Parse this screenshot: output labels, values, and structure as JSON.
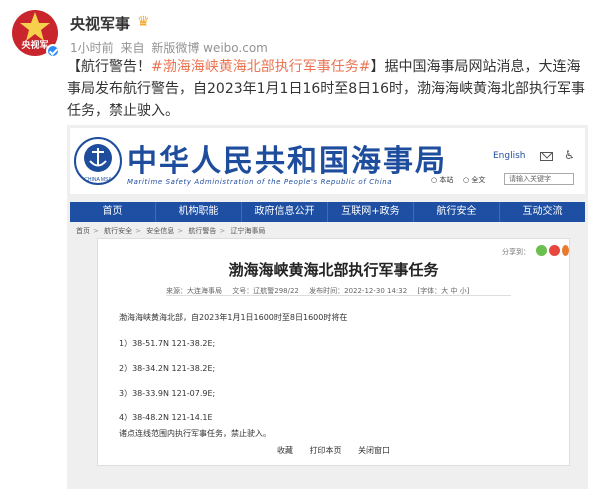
{
  "account": {
    "name": "央视军事",
    "avatar_text": "央视军",
    "time": "1小时前",
    "source_prefix": "来自",
    "source": "新版微博 weibo.com"
  },
  "post": {
    "prefix": "【航行警告！",
    "tag": "#渤海海峡黄海北部执行军事任务#",
    "body": "】据中国海事局网站消息，大连海事局发布航行警告，自2023年1月1日16时至8日16时，渤海海峡黄海北部执行军事任务，禁止驶入。"
  },
  "screenshot": {
    "site_title": "中华人民共和国海事局",
    "site_title_en": "Maritime Safety Administration of the People's Republic of China",
    "logo_text": "CHINA MSA",
    "english_link": "English",
    "search_options": [
      "本站",
      "全文"
    ],
    "search_placeholder": "请输入关键字",
    "nav": [
      "首页",
      "机构职能",
      "政府信息公开",
      "互联网+政务",
      "航行安全",
      "互动交流"
    ],
    "breadcrumb": [
      "首页",
      "航行安全",
      "安全信息",
      "航行警告",
      "辽宁海事局"
    ],
    "share_label": "分享到：",
    "article": {
      "title": "渤海海峡黄海北部执行军事任务",
      "meta": [
        "来源：大连海事局",
        "文号：辽航警298/22",
        "发布时间：2022-12-30 14:32",
        "[字体：大  中  小]"
      ],
      "intro": "渤海海峡黄海北部，自2023年1月1日1600时至8日1600时将在",
      "coords": [
        "1）38-51.7N   121-38.2E;",
        "2）38-34.2N   121-38.2E;",
        "3）38-33.9N   121-07.9E;",
        "4）38-48.2N   121-14.1E"
      ],
      "closing": "诸点连线范围内执行军事任务，禁止驶入。"
    },
    "footer": [
      "收藏",
      "打印本页",
      "关闭窗口"
    ]
  }
}
